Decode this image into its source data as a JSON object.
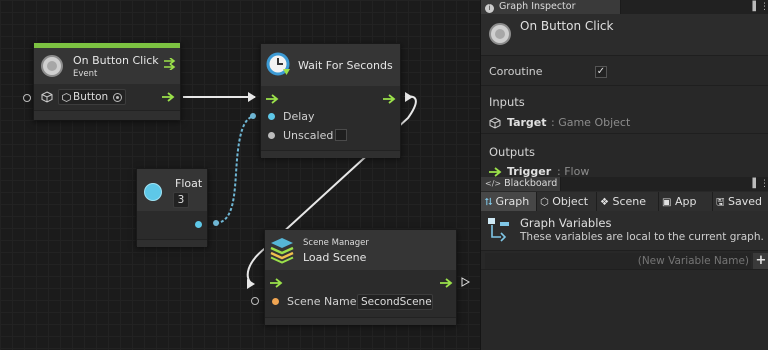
{
  "graph": {
    "nodes": {
      "on_button_click": {
        "title": "On Button Click",
        "subtitle": "Event",
        "field_value": "Button",
        "accent_color": "#7cc241"
      },
      "wait_for_seconds": {
        "title": "Wait For Seconds",
        "delay_label": "Delay",
        "unscaled_label": "Unscaled"
      },
      "float": {
        "title": "Float",
        "value": "3"
      },
      "load_scene": {
        "category": "Scene Manager",
        "title": "Load Scene",
        "scene_name_label": "Scene Name",
        "scene_name_value": "SecondScene"
      }
    },
    "colors": {
      "flow": "#9be14a",
      "float_port": "#5ec8e8",
      "object_port": "#bdbdbd",
      "string_port": "#f0a552",
      "wire_white": "#e8e8e8",
      "wire_blue": "#6fb7d5"
    }
  },
  "graph_inspector": {
    "tab_label": "Graph Inspector",
    "title": "On Button Click",
    "coroutine_label": "Coroutine",
    "coroutine_checked": true,
    "inputs_label": "Inputs",
    "target_name": "Target",
    "target_type": ": Game Object",
    "outputs_label": "Outputs",
    "trigger_name": "Trigger",
    "trigger_type": ": Flow"
  },
  "blackboard": {
    "tab_label": "Blackboard",
    "tabs": [
      "Graph",
      "Object",
      "Scene",
      "App",
      "Saved"
    ],
    "active_tab": "Graph",
    "section_title": "Graph Variables",
    "section_description": "These variables are local to the current graph.",
    "new_variable_placeholder": "(New Variable Name)",
    "add_label": "+"
  }
}
